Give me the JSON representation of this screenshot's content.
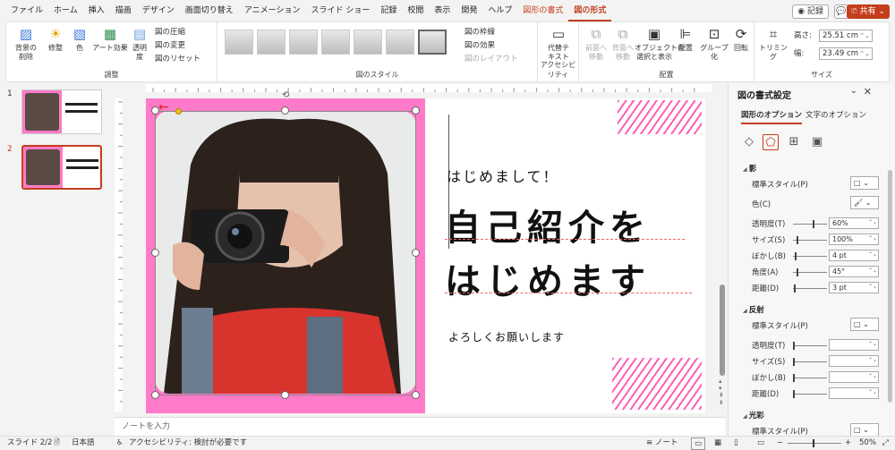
{
  "menu": [
    {
      "label": "ファイル",
      "type": "normal"
    },
    {
      "label": "ホーム",
      "type": "normal"
    },
    {
      "label": "挿入",
      "type": "normal"
    },
    {
      "label": "描画",
      "type": "normal"
    },
    {
      "label": "デザイン",
      "type": "normal"
    },
    {
      "label": "画面切り替え",
      "type": "normal"
    },
    {
      "label": "アニメーション",
      "type": "normal"
    },
    {
      "label": "スライド ショー",
      "type": "normal"
    },
    {
      "label": "記録",
      "type": "normal"
    },
    {
      "label": "校閲",
      "type": "normal"
    },
    {
      "label": "表示",
      "type": "normal"
    },
    {
      "label": "開発",
      "type": "normal"
    },
    {
      "label": "ヘルプ",
      "type": "normal"
    },
    {
      "label": "図形の書式",
      "type": "ctx"
    },
    {
      "label": "図の形式",
      "type": "active"
    }
  ],
  "top_right": {
    "record": "◉ 記録",
    "comment": "💬",
    "share": "🗈 共有 ⌄"
  },
  "ribbon": {
    "remove_bg": "背景の\n削除",
    "corrections": "修整",
    "color": "色",
    "art_effects": "アート効果",
    "transparency": "透明\n度",
    "compress": "図の圧縮",
    "change": "図の変更",
    "reset": "図のリセット",
    "adjust_label": "調整",
    "style_label": "図のスタイル",
    "border": "図の枠線",
    "effects": "図の効果",
    "layout": "図のレイアウト",
    "alt_text": "代替テ\nキスト",
    "access_label": "アクセシビリティ",
    "forward": "前面へ\n移動",
    "backward": "背面へ\n移動",
    "sel_pane": "オブジェクトの\n選択と表示",
    "align": "配置",
    "group": "グループ化",
    "rotate": "回転",
    "arrange_label": "配置",
    "crop": "トリミング",
    "height_label": "高さ:",
    "height": "25.51 cm",
    "width_label": "幅:",
    "width": "23.49 cm",
    "size_label": "サイズ"
  },
  "slides": [
    {
      "num": "1"
    },
    {
      "num": "2"
    }
  ],
  "slide": {
    "line1": "はじめまして！",
    "line2": "自己紹介を",
    "line3": "はじめます",
    "line4": "よろしくお願いします"
  },
  "notes_placeholder": "ノートを入力",
  "pane": {
    "title": "図の書式設定",
    "tab1": "図形のオプション",
    "tab2": "文字のオプション",
    "shadow": "影",
    "shadow_rows": [
      {
        "label": "標準スタイル(P)",
        "type": "drop",
        "value": "□ ⌄"
      },
      {
        "label": "色(C)",
        "type": "drop",
        "value": "🖌 ⌄"
      },
      {
        "label": "透明度(T)",
        "type": "val",
        "value": "60%",
        "knob": 0.6
      },
      {
        "label": "サイズ(S)",
        "type": "val",
        "value": "100%",
        "knob": 0.1
      },
      {
        "label": "ぼかし(B)",
        "type": "val",
        "value": "4 pt",
        "knob": 0.05
      },
      {
        "label": "角度(A)",
        "type": "val",
        "value": "45°",
        "knob": 0.12
      },
      {
        "label": "距離(D)",
        "type": "val",
        "value": "3 pt",
        "knob": 0.02
      }
    ],
    "reflection": "反射",
    "reflection_rows": [
      {
        "label": "標準スタイル(P)",
        "type": "drop",
        "value": "□ ⌄"
      },
      {
        "label": "透明度(T)",
        "type": "val",
        "value": "",
        "knob": 0.0
      },
      {
        "label": "サイズ(S)",
        "type": "val",
        "value": "",
        "knob": 0.0
      },
      {
        "label": "ぼかし(B)",
        "type": "val",
        "value": "",
        "knob": 0.0
      },
      {
        "label": "距離(D)",
        "type": "val",
        "value": "",
        "knob": 0.0
      }
    ],
    "glow": "光彩",
    "glow_rows": [
      {
        "label": "標準スタイル(P)",
        "type": "drop",
        "value": "□ ⌄"
      }
    ]
  },
  "status": {
    "slide": "スライド 2/2",
    "lang": "日本語",
    "access": "アクセシビリティ: 検討が必要です",
    "notes": "≡ ノート",
    "zoom": "50%"
  }
}
